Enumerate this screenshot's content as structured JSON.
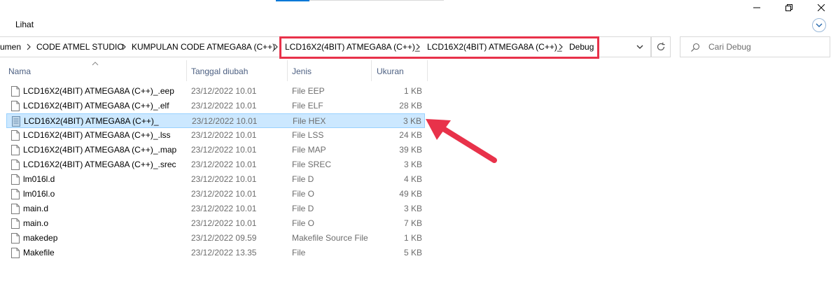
{
  "window": {
    "minimize_icon": "minimize-icon",
    "restore_icon": "restore-icon",
    "close_icon": "close-icon"
  },
  "ribbon": {
    "tab_view": "Lihat"
  },
  "address": {
    "crumbs": [
      "umen",
      "CODE ATMEL STUDIO",
      "KUMPULAN CODE ATMEGA8A (C++)",
      "LCD16X2(4BIT) ATMEGA8A (C++)_",
      "LCD16X2(4BIT) ATMEGA8A (C++)_",
      "Debug"
    ]
  },
  "search": {
    "placeholder": "Cari Debug"
  },
  "columns": {
    "name": "Nama",
    "date": "Tanggal diubah",
    "type": "Jenis",
    "size": "Ukuran"
  },
  "files": [
    {
      "name": "LCD16X2(4BIT) ATMEGA8A (C++)_.eep",
      "date": "23/12/2022 10.01",
      "type": "File EEP",
      "size": "1 KB"
    },
    {
      "name": "LCD16X2(4BIT) ATMEGA8A (C++)_.elf",
      "date": "23/12/2022 10.01",
      "type": "File ELF",
      "size": "28 KB"
    },
    {
      "name": "LCD16X2(4BIT) ATMEGA8A (C++)_",
      "date": "23/12/2022 10.01",
      "type": "File HEX",
      "size": "3 KB"
    },
    {
      "name": "LCD16X2(4BIT) ATMEGA8A (C++)_.lss",
      "date": "23/12/2022 10.01",
      "type": "File LSS",
      "size": "24 KB"
    },
    {
      "name": "LCD16X2(4BIT) ATMEGA8A (C++)_.map",
      "date": "23/12/2022 10.01",
      "type": "File MAP",
      "size": "39 KB"
    },
    {
      "name": "LCD16X2(4BIT) ATMEGA8A (C++)_.srec",
      "date": "23/12/2022 10.01",
      "type": "File SREC",
      "size": "3 KB"
    },
    {
      "name": "lm016l.d",
      "date": "23/12/2022 10.01",
      "type": "File D",
      "size": "4 KB"
    },
    {
      "name": "lm016l.o",
      "date": "23/12/2022 10.01",
      "type": "File O",
      "size": "49 KB"
    },
    {
      "name": "main.d",
      "date": "23/12/2022 10.01",
      "type": "File D",
      "size": "3 KB"
    },
    {
      "name": "main.o",
      "date": "23/12/2022 10.01",
      "type": "File O",
      "size": "7 KB"
    },
    {
      "name": "makedep",
      "date": "23/12/2022 09.59",
      "type": "Makefile Source File",
      "size": "1 KB"
    },
    {
      "name": "Makefile",
      "date": "23/12/2022 13.35",
      "type": "File",
      "size": "5 KB"
    }
  ],
  "selected_index": 2,
  "colors": {
    "highlight_box": "#e8324a",
    "selection_bg": "#cce8ff",
    "selection_border": "#99d1ff",
    "annotation_arrow": "#e8324a"
  }
}
